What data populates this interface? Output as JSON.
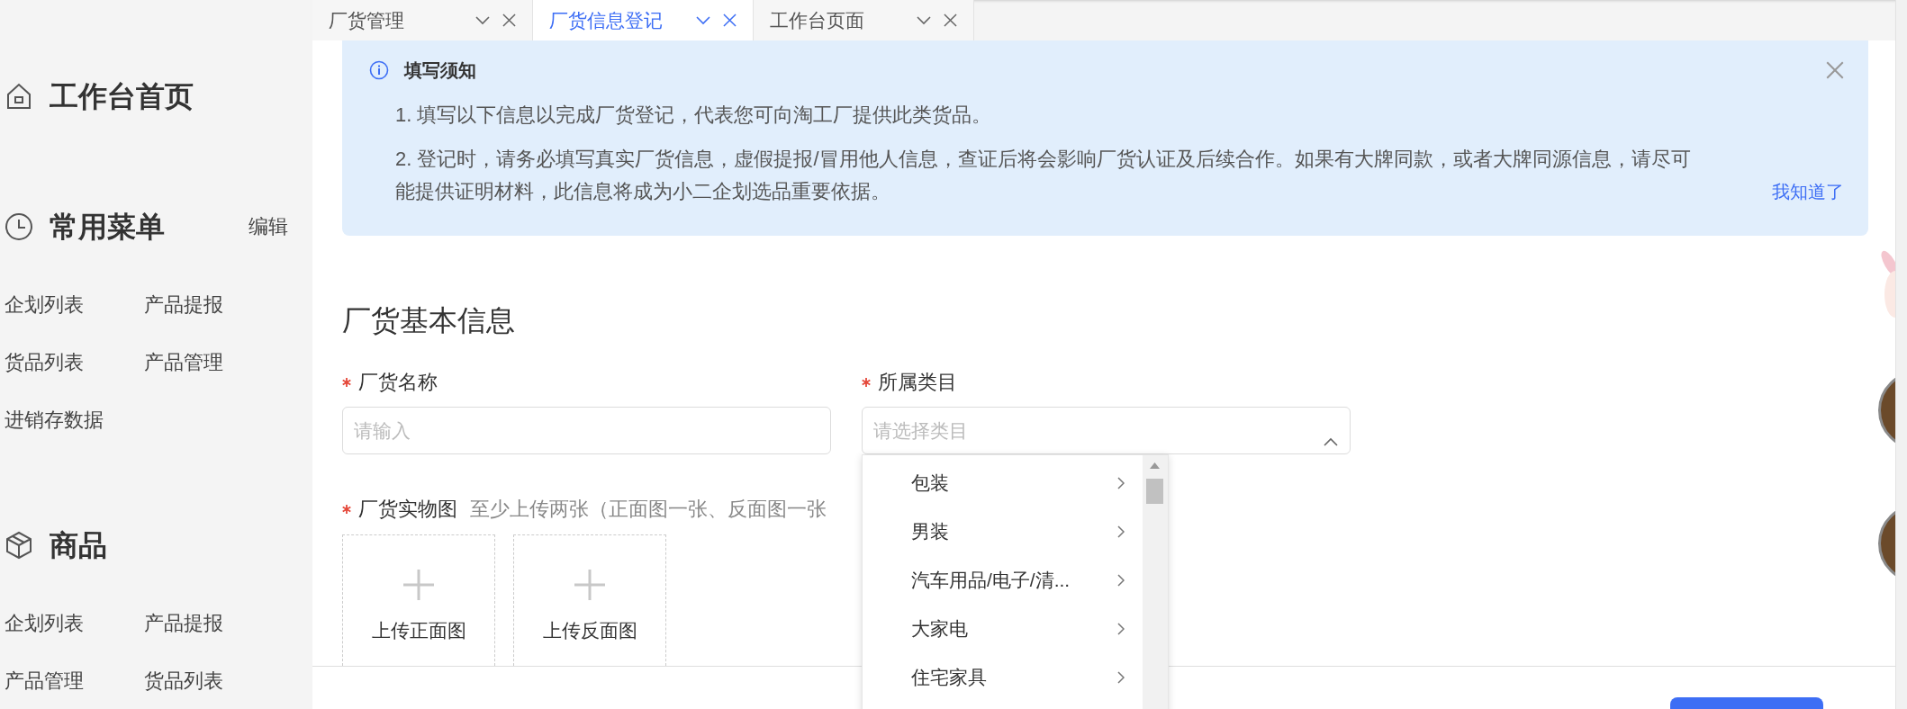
{
  "sidebar": {
    "sections": [
      {
        "kind": "home",
        "title": "工作台首页"
      },
      {
        "kind": "recent",
        "title": "常用菜单",
        "action": "编辑",
        "items": [
          "企划列表",
          "产品提报",
          "货品列表",
          "产品管理",
          "进销存数据"
        ]
      },
      {
        "kind": "goods",
        "title": "商品",
        "items": [
          "企划列表",
          "产品提报",
          "产品管理",
          "货品列表"
        ]
      }
    ]
  },
  "tabs": [
    {
      "label": "厂货管理",
      "selected": false
    },
    {
      "label": "厂货信息登记",
      "selected": true
    },
    {
      "label": "工作台页面",
      "selected": false
    }
  ],
  "notice": {
    "title": "填写须知",
    "lines": [
      "1. 填写以下信息以完成厂货登记，代表您可向淘工厂提供此类货品。",
      "2. 登记时，请务必填写真实厂货信息，虚假提报/冒用他人信息，查证后将会影响厂货认证及后续合作。如果有大牌同款，或者大牌同源信息，请尽可能提供证明材料，此信息将成为小二企划选品重要依据。"
    ],
    "confirm_link": "我知道了"
  },
  "form": {
    "section_title": "厂货基本信息",
    "fields": [
      {
        "kind": "text",
        "label": "厂货名称",
        "required": true,
        "placeholder": "请输入"
      },
      {
        "kind": "select",
        "label": "所属类目",
        "required": true,
        "placeholder": "请选择类目",
        "expanded": true
      }
    ],
    "upload": {
      "label": "厂货实物图",
      "required": true,
      "hint": "至少上传两张（正面图一张、反面图一张",
      "slots": [
        "上传正面图",
        "上传反面图"
      ]
    }
  },
  "category_dropdown": {
    "options": [
      {
        "label": "包装",
        "has_children": true
      },
      {
        "label": "男装",
        "has_children": true
      },
      {
        "label": "汽车用品/电子/清...",
        "has_children": true
      },
      {
        "label": "大家电",
        "has_children": true
      },
      {
        "label": "住宅家具",
        "has_children": true
      }
    ]
  }
}
